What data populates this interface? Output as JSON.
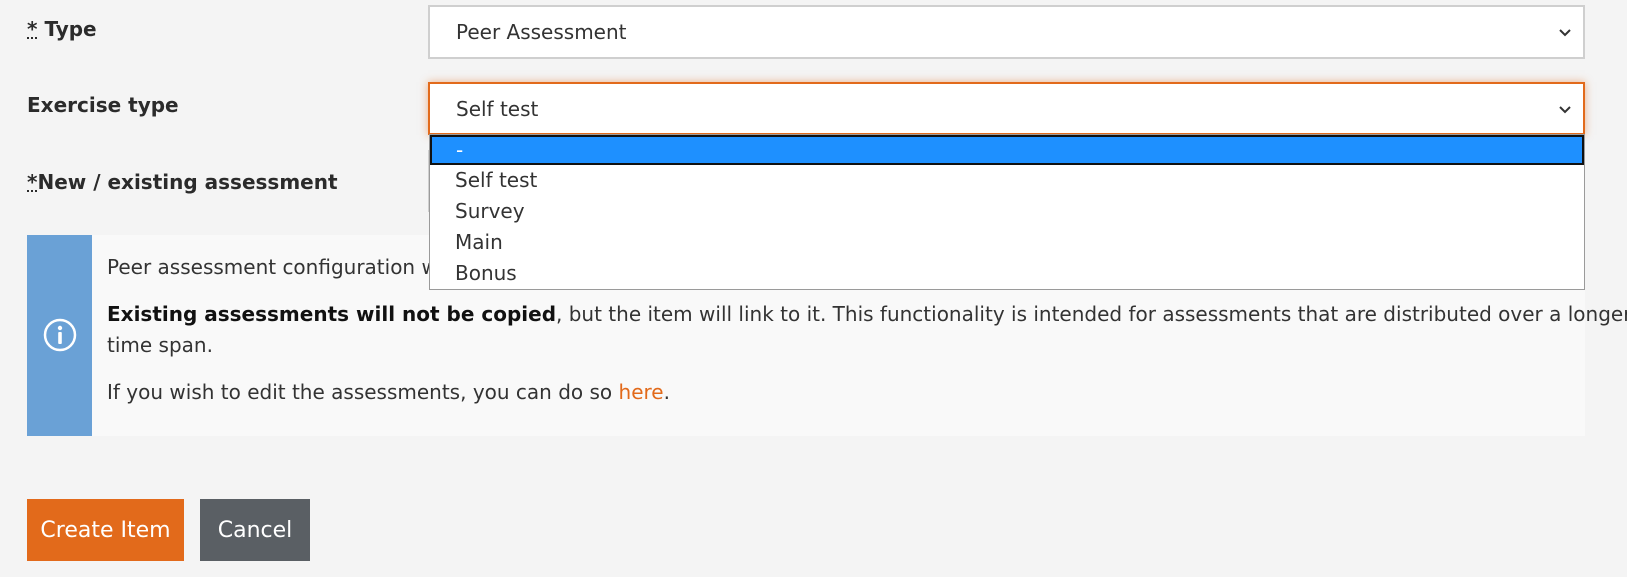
{
  "form": {
    "type_required_marker": "*",
    "type_label": "Type",
    "type_value": "Peer Assessment",
    "exercise_type_label": "Exercise type",
    "exercise_type_value": "Self test",
    "assessment_required_marker": "*",
    "assessment_label": "New / existing assessment"
  },
  "dropdown": {
    "options": [
      "-",
      "Self test",
      "Survey",
      "Main",
      "Bonus"
    ],
    "highlighted": "-"
  },
  "info": {
    "line1": "Peer assessment configuration wi",
    "line2_bold": "Existing assessments will not be copied",
    "line2_rest": ", but the item will link to it. This functionality is intended for assessments that are distributed over a longer",
    "line3": "time span.",
    "line4_pre": "If you wish to edit the assessments, you can do so ",
    "line4_link": "here",
    "line4_post": "."
  },
  "actions": {
    "create_label": "Create Item",
    "cancel_label": "Cancel"
  },
  "colors": {
    "accent": "#e26a1b",
    "info_bar": "#6aa1d6",
    "highlight": "#1e90ff",
    "cancel": "#5a5f64"
  },
  "icons": {
    "select_arrow": "chevron-down-icon",
    "info": "info-circle-icon"
  }
}
